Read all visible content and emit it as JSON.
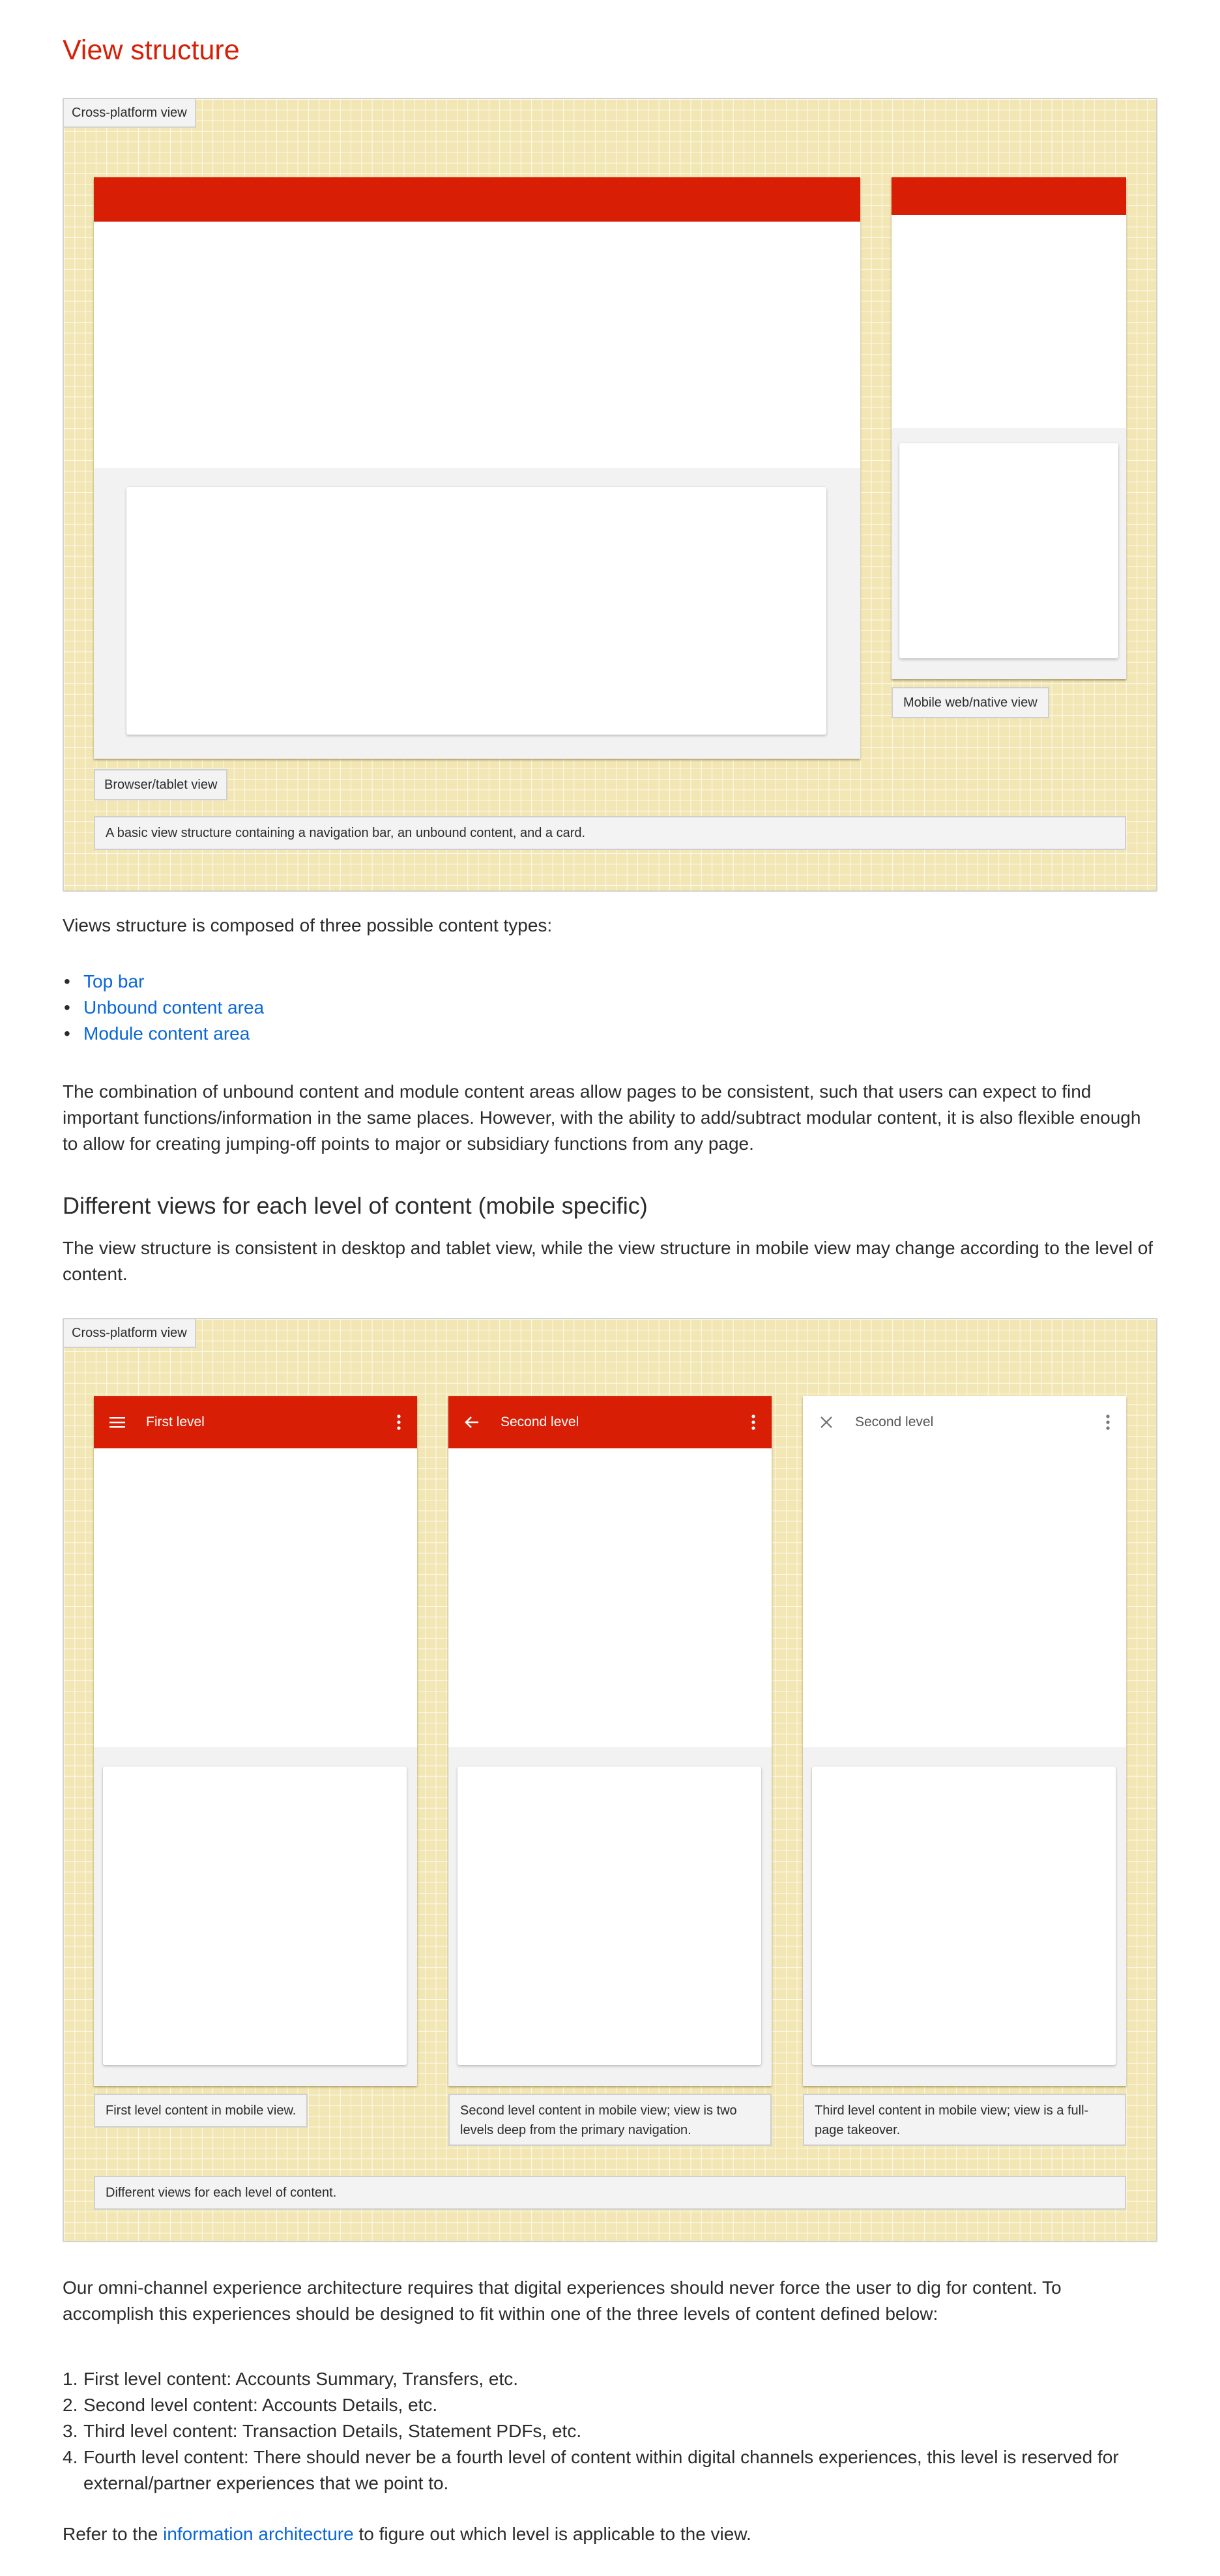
{
  "page": {
    "title": "View structure"
  },
  "colors": {
    "brand_red": "#d91e06",
    "title_red": "#d61f06",
    "link_blue": "#0a66d8",
    "grid_background": "#f2e7b4",
    "caption_background": "#f3f3f3",
    "content_gray": "#f2f2f2"
  },
  "demo1": {
    "tag": "Cross-platform view",
    "browser_caption": "Browser/tablet view",
    "mobile_caption": "Mobile web/native view",
    "description": "A basic view structure containing a navigation bar, an unbound content, and a card."
  },
  "intro": {
    "lead": "Views structure is composed of three possible content types:",
    "content_types": [
      {
        "label": "Top bar"
      },
      {
        "label": "Unbound content area"
      },
      {
        "label": "Module content area"
      }
    ],
    "combination_paragraph": "The combination of unbound content and module content areas allow pages to be consistent, such that users can expect to find important functions/information in the same places. However, with the ability to add/subtract modular content, it is also flexible enough to allow for creating jumping-off points to major or subsidiary functions from any page."
  },
  "levels_section": {
    "heading": "Different views for each level of content (mobile specific)",
    "paragraph": "The view structure is consistent in desktop and tablet view, while the view structure in mobile view may change according to the level of content."
  },
  "demo2": {
    "tag": "Cross-platform view",
    "views": [
      {
        "nav_icon": "menu-icon",
        "title": "First level",
        "action_icon": "more-vert-icon",
        "style": "red",
        "caption": "First level content in mobile view."
      },
      {
        "nav_icon": "arrow-back-icon",
        "title": "Second level",
        "action_icon": "more-vert-icon",
        "style": "red",
        "caption": "Second level content in mobile view; view is two levels deep from the primary navigation."
      },
      {
        "nav_icon": "close-icon",
        "title": "Second level",
        "action_icon": "more-vert-icon",
        "style": "white",
        "caption": "Third level content in mobile view; view is a full-page takeover."
      }
    ],
    "description": "Different views for each level of content."
  },
  "architecture": {
    "paragraph": "Our omni-channel experience architecture requires that digital experiences should never force the user to dig for content. To accomplish this experiences should be designed to fit within one of the three levels of content defined below:",
    "levels": [
      {
        "num": "1.",
        "text": "First level content: Accounts Summary, Transfers, etc."
      },
      {
        "num": "2.",
        "text": "Second level content: Accounts Details, etc."
      },
      {
        "num": "3.",
        "text": "Third level content: Transaction Details, Statement PDFs, etc."
      },
      {
        "num": "4.",
        "text": "Fourth level content: There should never be a fourth level of content within digital channels experiences, this level is reserved for external/partner experiences that we point to."
      }
    ],
    "refer_prefix": "Refer to the ",
    "refer_link": "information architecture",
    "refer_suffix": " to figure out which level is applicable to the view."
  }
}
